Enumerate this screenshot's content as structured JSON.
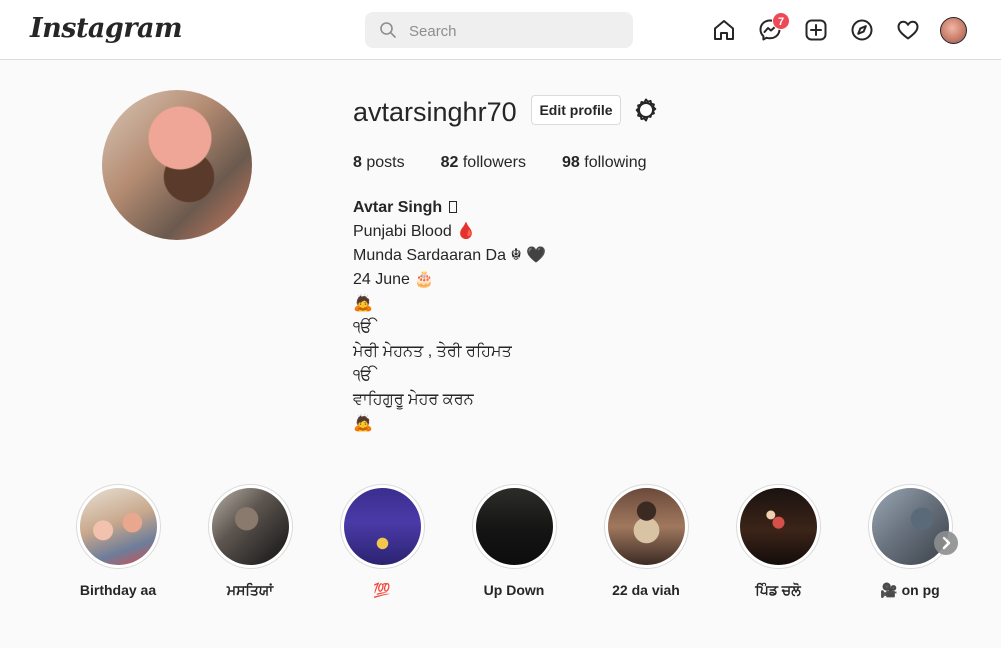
{
  "nav": {
    "logo": "Instagram",
    "search_placeholder": "Search",
    "messages_badge": "7",
    "icons": [
      "home-icon",
      "messenger-icon",
      "new-post-icon",
      "explore-icon",
      "activity-heart-icon",
      "profile-avatar"
    ]
  },
  "profile": {
    "username": "avtarsinghr70",
    "edit_label": "Edit profile",
    "stats": {
      "posts_count": "8",
      "posts_label": "posts",
      "followers_count": "82",
      "followers_label": "followers",
      "following_count": "98",
      "following_label": "following"
    },
    "bio": {
      "name": "Avtar Singh",
      "lines": [
        "Punjabi Blood 🩸",
        "Munda Sardaaran Da ☬ 🖤",
        "24 June 🎂",
        "🙇",
        "ੴ",
        "ਮੇਰੀ ਮੇਹਨਤ , ਤੇਰੀ ਰਹਿਮਤ",
        "ੴ",
        "ਵਾਹਿਗੁਰੂ ਮੇਹਰ ਕਰਨ",
        "🙇"
      ]
    }
  },
  "highlights": [
    {
      "label": "Birthday aa"
    },
    {
      "label": "ਮਸਤਿਯਾਂ"
    },
    {
      "label": "💯"
    },
    {
      "label": "Up Down"
    },
    {
      "label": "22 da viah"
    },
    {
      "label": "ਪਿੰਡ ਚਲੋ"
    },
    {
      "label": "🎥 on pg"
    }
  ],
  "colors": {
    "badge": "#ed4956",
    "border": "#dbdbdb",
    "text": "#262626",
    "muted": "#8e8e8e"
  }
}
